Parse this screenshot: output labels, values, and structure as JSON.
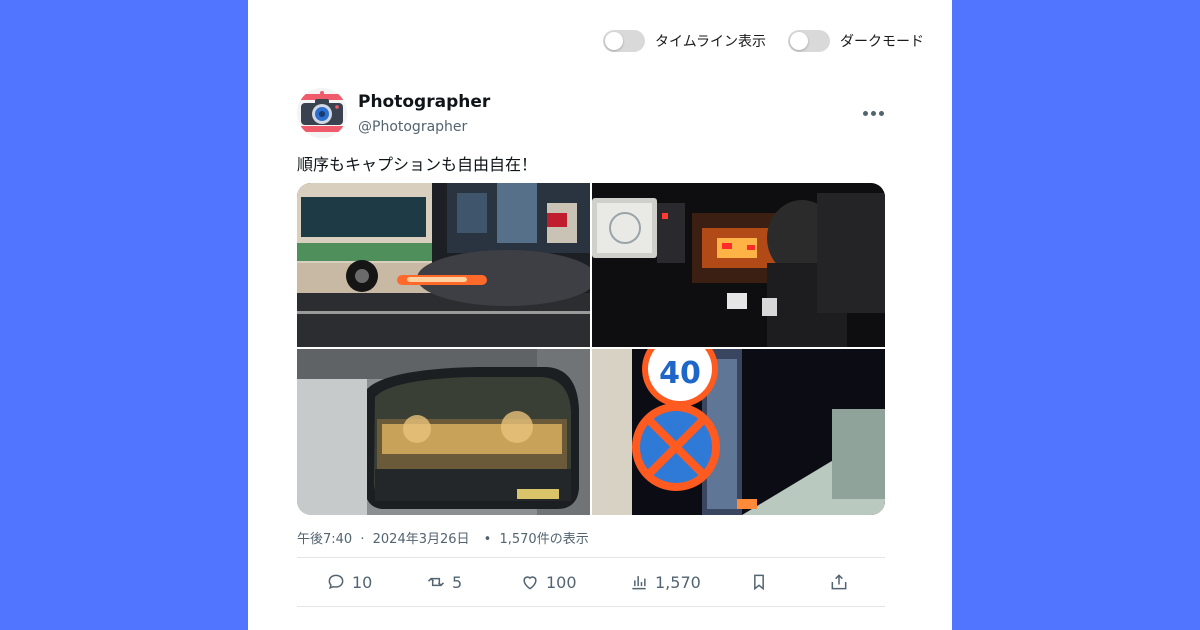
{
  "toggles": [
    {
      "label": "タイムライン表示",
      "state": "off"
    },
    {
      "label": "ダークモード",
      "state": "off"
    }
  ],
  "post": {
    "author_name": "Photographer",
    "author_handle": "@Photographer",
    "text": "順序もキャプションも自由自在！",
    "time": "午後7:40",
    "date": "2024年3月26日",
    "views_text": "1,570件の表示",
    "separator": "·",
    "bullet": "•"
  },
  "images": [
    {
      "icon": "night-street-bus-photo"
    },
    {
      "icon": "taxi-interior-photo"
    },
    {
      "icon": "car-window-photo"
    },
    {
      "icon": "speed-sign-photo"
    }
  ],
  "actions": {
    "replies": "10",
    "retweets": "5",
    "likes": "100",
    "views": "1,570"
  },
  "colors": {
    "background": "#5275ff",
    "card": "#ffffff",
    "muted": "#536471"
  }
}
